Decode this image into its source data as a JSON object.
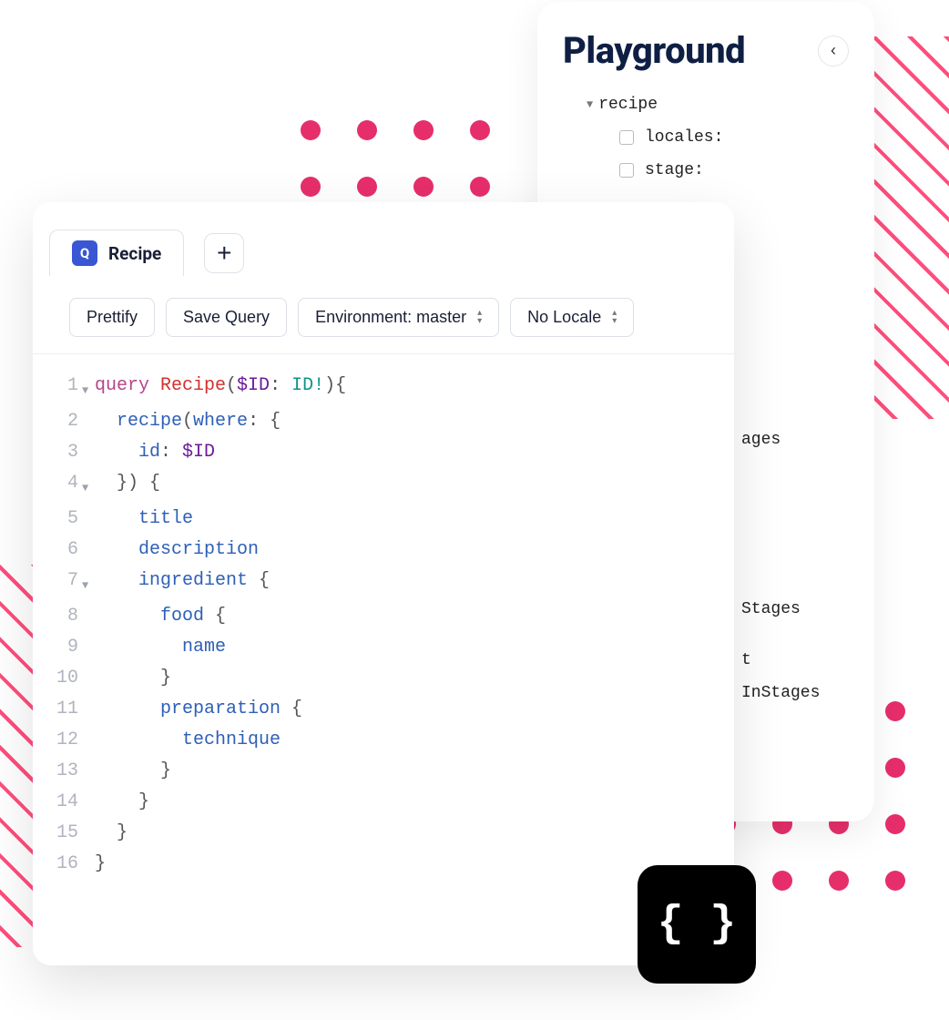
{
  "playground": {
    "title": "Playground",
    "tree": {
      "root": "recipe",
      "items": [
        {
          "label": "locales:"
        },
        {
          "label": "stage:"
        }
      ],
      "partial": [
        "ages",
        "Stages",
        "t",
        "InStages"
      ]
    }
  },
  "editor": {
    "tab_badge": "Q",
    "tab_label": "Recipe",
    "toolbar": {
      "prettify": "Prettify",
      "save": "Save Query",
      "environment": "Environment: master",
      "locale": "No Locale"
    },
    "code": [
      {
        "n": "1",
        "fold": true,
        "tokens": [
          [
            "kw",
            "query "
          ],
          [
            "name",
            "Recipe"
          ],
          [
            "punct",
            "("
          ],
          [
            "var",
            "$ID"
          ],
          [
            "punct",
            ": "
          ],
          [
            "type",
            "ID!"
          ],
          [
            "punct",
            "){"
          ]
        ]
      },
      {
        "n": "2",
        "fold": false,
        "tokens": [
          [
            "plain",
            "  "
          ],
          [
            "field",
            "recipe"
          ],
          [
            "punct",
            "("
          ],
          [
            "arg",
            "where"
          ],
          [
            "punct",
            ": {"
          ]
        ]
      },
      {
        "n": "3",
        "fold": false,
        "tokens": [
          [
            "plain",
            "    "
          ],
          [
            "attr",
            "id"
          ],
          [
            "punct",
            ": "
          ],
          [
            "var",
            "$ID"
          ]
        ]
      },
      {
        "n": "4",
        "fold": true,
        "tokens": [
          [
            "plain",
            "  "
          ],
          [
            "punct",
            "}) {"
          ]
        ]
      },
      {
        "n": "5",
        "fold": false,
        "tokens": [
          [
            "plain",
            "    "
          ],
          [
            "field",
            "title"
          ]
        ]
      },
      {
        "n": "6",
        "fold": false,
        "tokens": [
          [
            "plain",
            "    "
          ],
          [
            "field",
            "description"
          ]
        ]
      },
      {
        "n": "7",
        "fold": true,
        "tokens": [
          [
            "plain",
            "    "
          ],
          [
            "field",
            "ingredient"
          ],
          [
            "punct",
            " {"
          ]
        ]
      },
      {
        "n": "8",
        "fold": false,
        "tokens": [
          [
            "plain",
            "      "
          ],
          [
            "field",
            "food"
          ],
          [
            "punct",
            " {"
          ]
        ]
      },
      {
        "n": "9",
        "fold": false,
        "tokens": [
          [
            "plain",
            "        "
          ],
          [
            "field",
            "name"
          ]
        ]
      },
      {
        "n": "10",
        "fold": false,
        "tokens": [
          [
            "plain",
            "      "
          ],
          [
            "punct",
            "}"
          ]
        ]
      },
      {
        "n": "11",
        "fold": false,
        "tokens": [
          [
            "plain",
            "      "
          ],
          [
            "field",
            "preparation"
          ],
          [
            "punct",
            " {"
          ]
        ]
      },
      {
        "n": "12",
        "fold": false,
        "tokens": [
          [
            "plain",
            "        "
          ],
          [
            "field",
            "technique"
          ]
        ]
      },
      {
        "n": "13",
        "fold": false,
        "tokens": [
          [
            "plain",
            "      "
          ],
          [
            "punct",
            "}"
          ]
        ]
      },
      {
        "n": "14",
        "fold": false,
        "tokens": [
          [
            "plain",
            "    "
          ],
          [
            "punct",
            "}"
          ]
        ]
      },
      {
        "n": "15",
        "fold": false,
        "tokens": [
          [
            "plain",
            "  "
          ],
          [
            "punct",
            "}"
          ]
        ]
      },
      {
        "n": "16",
        "fold": false,
        "tokens": [
          [
            "punct",
            "}"
          ]
        ]
      }
    ]
  },
  "badge_glyph": "{ }"
}
